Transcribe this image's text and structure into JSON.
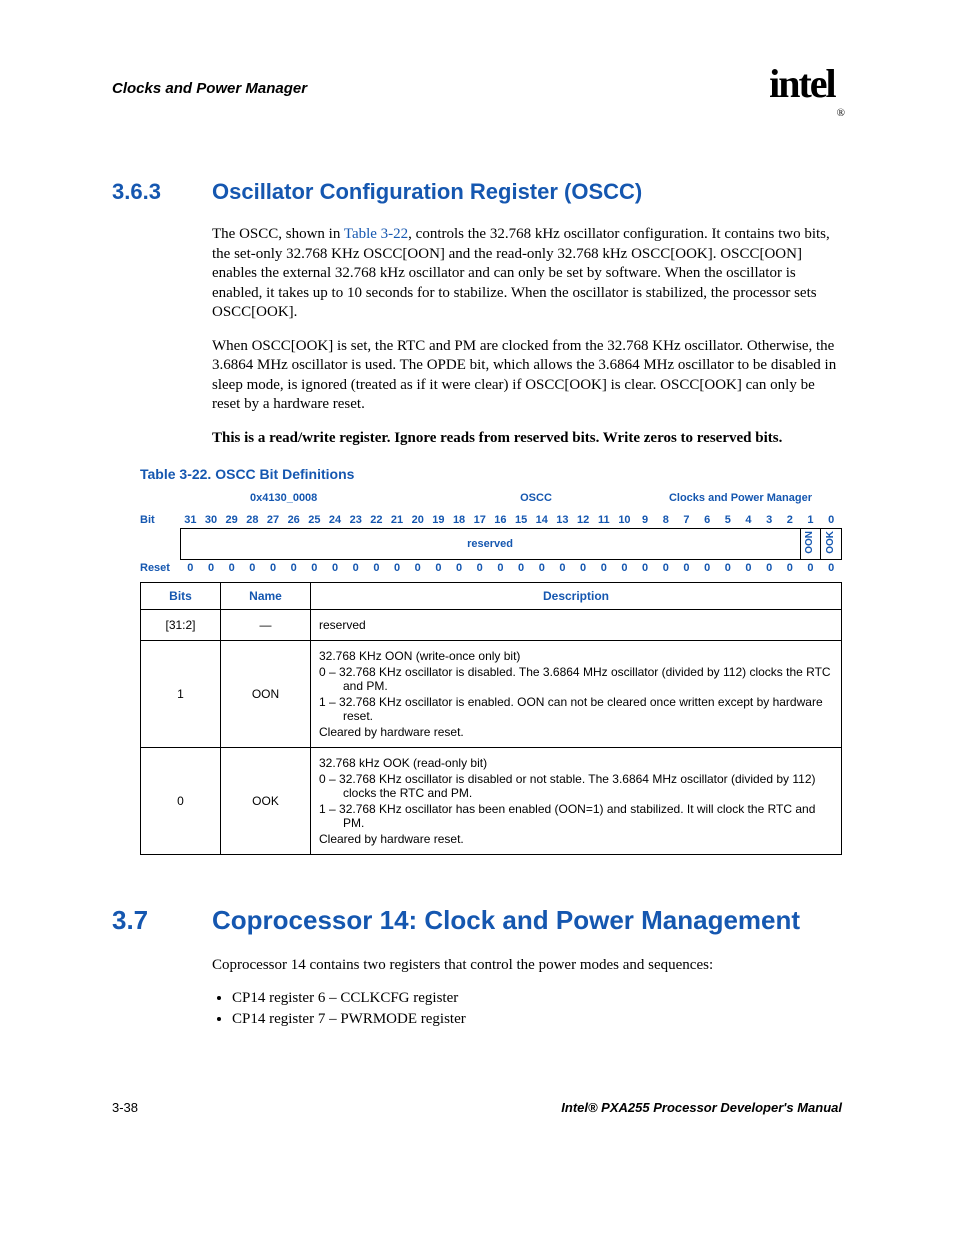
{
  "header": {
    "chapter": "Clocks and Power Manager",
    "logo": "intel",
    "reg": "®"
  },
  "s363": {
    "num": "3.6.3",
    "title": "Oscillator Configuration Register (OSCC)",
    "p1a": "The OSCC, shown in ",
    "p1link": "Table 3-22",
    "p1b": ", controls the 32.768 kHz oscillator configuration. It contains two bits, the set-only 32.768 KHz OSCC[OON] and the read-only 32.768 kHz OSCC[OOK]. OSCC[OON] enables the external 32.768 kHz oscillator and can only be set by software. When the oscillator is enabled, it takes up to 10 seconds for to stabilize. When the oscillator is stabilized, the processor sets OSCC[OOK].",
    "p2": "When OSCC[OOK] is set, the RTC and PM are clocked from the 32.768 KHz oscillator. Otherwise, the 3.6864 MHz oscillator is used. The OPDE bit, which allows the 3.6864 MHz oscillator to be disabled in sleep mode, is ignored (treated as if it were clear) if OSCC[OOK] is clear. OSCC[OOK] can only be reset by a hardware reset.",
    "p3": "This is a read/write register. Ignore reads from reserved bits. Write zeros to reserved bits."
  },
  "table322": {
    "caption": "Table 3-22. OSCC Bit Definitions",
    "addr": "0x4130_0008",
    "regname": "OSCC",
    "module": "Clocks and Power Manager",
    "bit_label": "Bit",
    "reset_label": "Reset",
    "bits": [
      "31",
      "30",
      "29",
      "28",
      "27",
      "26",
      "25",
      "24",
      "23",
      "22",
      "21",
      "20",
      "19",
      "18",
      "17",
      "16",
      "15",
      "14",
      "13",
      "12",
      "11",
      "10",
      "9",
      "8",
      "7",
      "6",
      "5",
      "4",
      "3",
      "2",
      "1",
      "0"
    ],
    "reserved": "reserved",
    "oon": "OON",
    "ook": "OOK",
    "reset": [
      "0",
      "0",
      "0",
      "0",
      "0",
      "0",
      "0",
      "0",
      "0",
      "0",
      "0",
      "0",
      "0",
      "0",
      "0",
      "0",
      "0",
      "0",
      "0",
      "0",
      "0",
      "0",
      "0",
      "0",
      "0",
      "0",
      "0",
      "0",
      "0",
      "0",
      "0",
      "0"
    ],
    "cols": {
      "bits": "Bits",
      "name": "Name",
      "desc": "Description"
    },
    "rows": [
      {
        "bits": "[31:2]",
        "name": "—",
        "lines": [
          "reserved"
        ]
      },
      {
        "bits": "1",
        "name": "OON",
        "lines": [
          "32.768 KHz OON (write-once only bit)",
          "0 –  32.768 KHz oscillator is disabled. The 3.6864 MHz oscillator (divided by 112) clocks the RTC and PM.",
          "1 –  32.768 KHz oscillator is enabled. OON can not be cleared once written except by hardware reset.",
          "Cleared by hardware reset."
        ]
      },
      {
        "bits": "0",
        "name": "OOK",
        "lines": [
          "32.768 kHz OOK (read-only bit)",
          "0 –  32.768 KHz oscillator is disabled or not stable. The 3.6864 MHz oscillator (divided by 112) clocks the RTC and PM.",
          "1 –  32.768 KHz oscillator has been enabled (OON=1) and stabilized. It will clock the RTC and PM.",
          "Cleared by hardware reset."
        ]
      }
    ]
  },
  "s37": {
    "num": "3.7",
    "title": "Coprocessor 14: Clock and Power Management",
    "intro": "Coprocessor 14 contains two registers that control the power modes and sequences:",
    "bullets": [
      "CP14 register 6 – CCLKCFG register",
      "CP14 register 7 – PWRMODE register"
    ]
  },
  "footer": {
    "page": "3-38",
    "manual": "Intel® PXA255 Processor Developer's Manual"
  }
}
